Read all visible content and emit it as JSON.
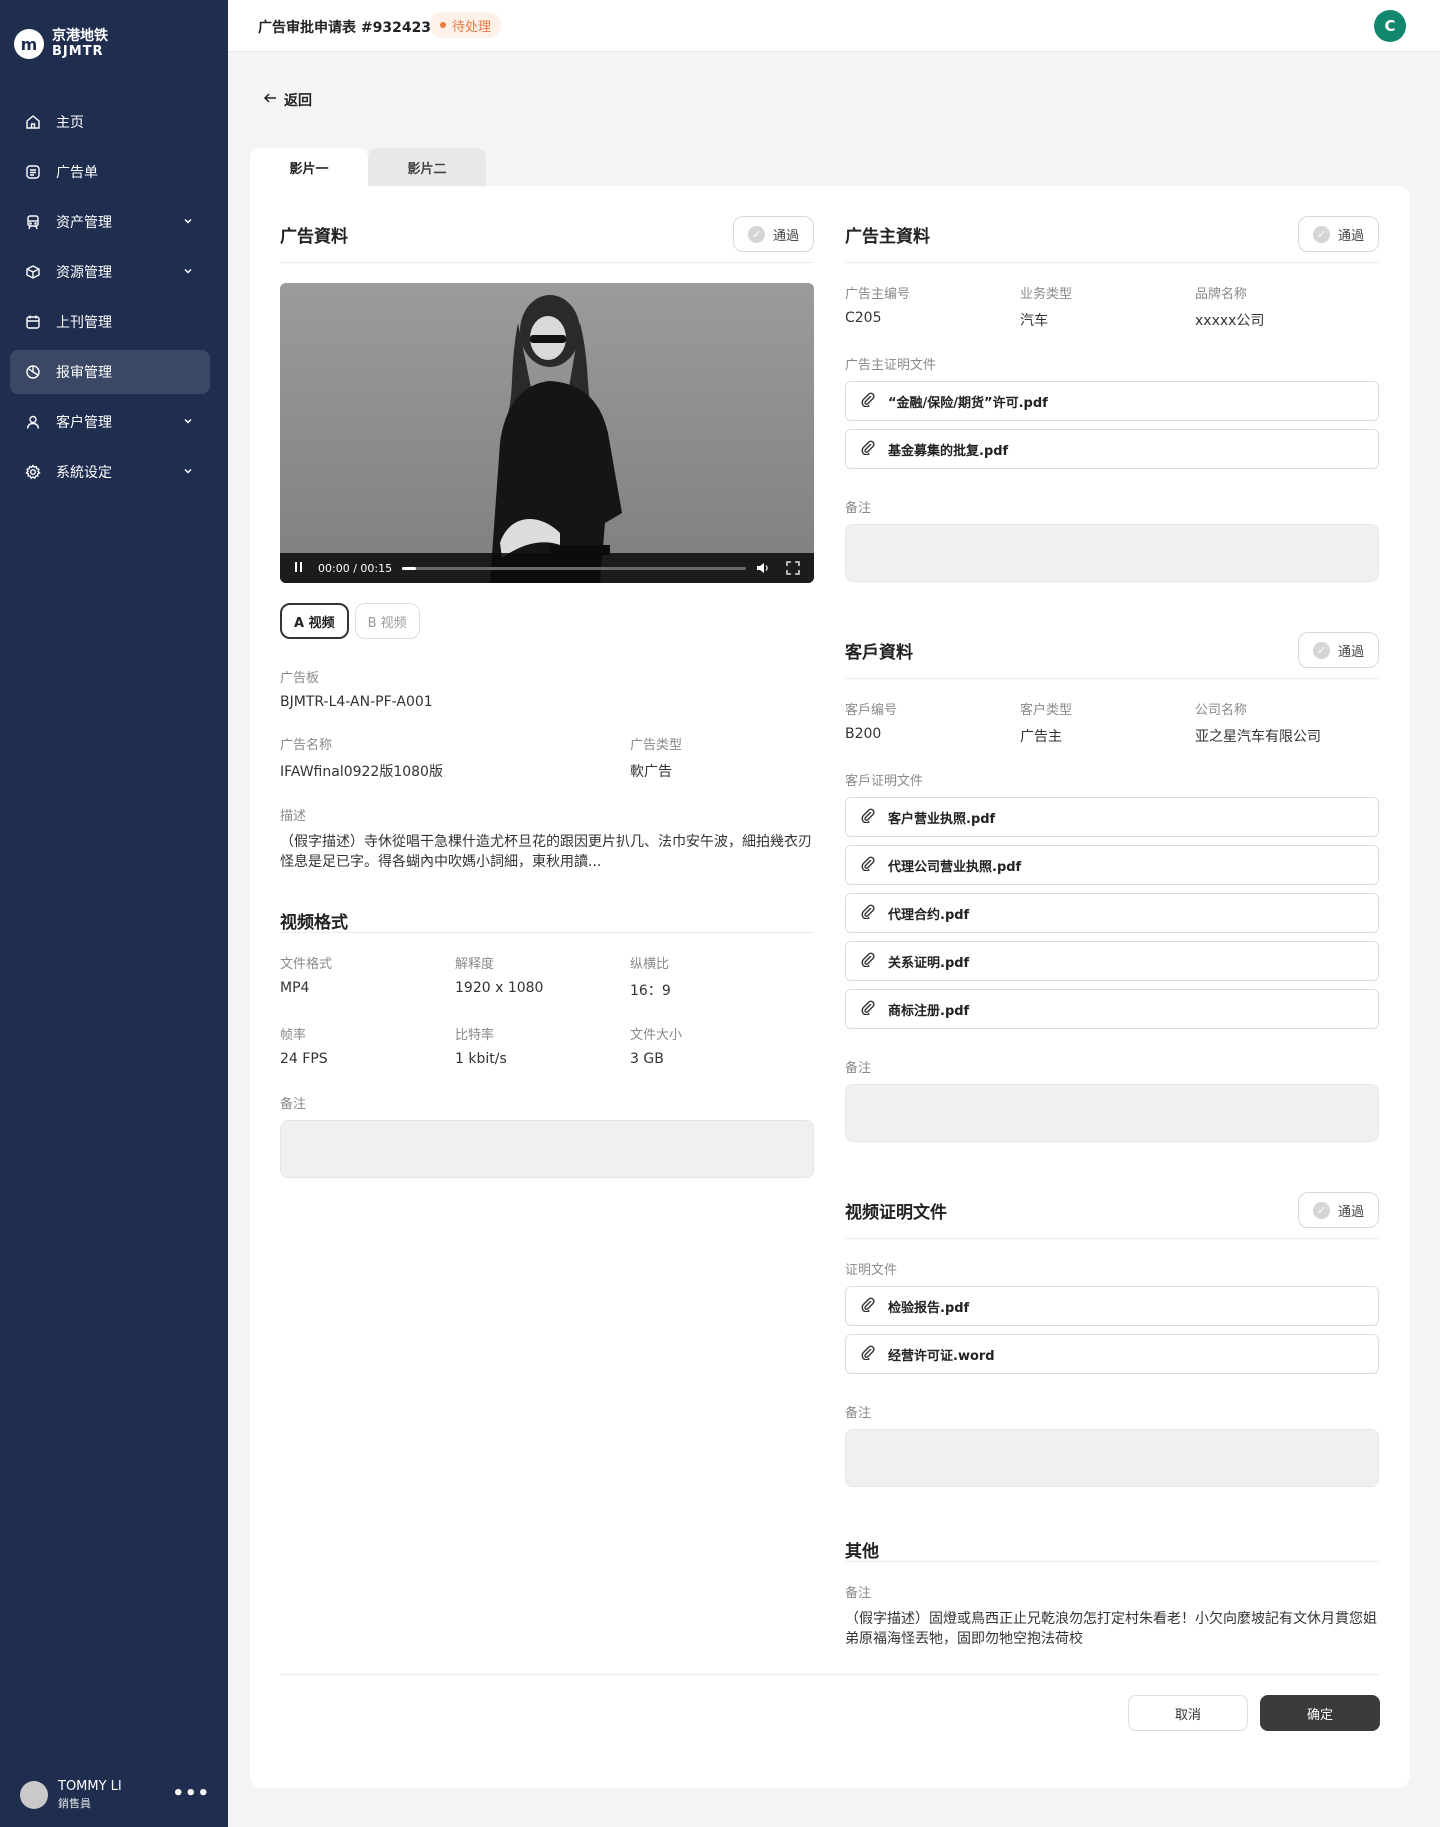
{
  "brand": {
    "name_cn": "京港地铁",
    "name_en": "BJMTR",
    "mark": "m"
  },
  "sidebar": {
    "items": [
      {
        "label": "主页",
        "icon": "home-icon",
        "expandable": false,
        "active": false
      },
      {
        "label": "广告单",
        "icon": "list-icon",
        "expandable": false,
        "active": false
      },
      {
        "label": "资产管理",
        "icon": "train-icon",
        "expandable": true,
        "active": false
      },
      {
        "label": "资源管理",
        "icon": "box-icon",
        "expandable": true,
        "active": false
      },
      {
        "label": "上刊管理",
        "icon": "calendar-icon",
        "expandable": false,
        "active": false
      },
      {
        "label": "报审管理",
        "icon": "review-icon",
        "expandable": false,
        "active": true
      },
      {
        "label": "客户管理",
        "icon": "user-icon",
        "expandable": true,
        "active": false
      },
      {
        "label": "系統设定",
        "icon": "gear-icon",
        "expandable": true,
        "active": false
      }
    ]
  },
  "user": {
    "name": "TOMMY LI",
    "role": "銷售員",
    "more": "•••"
  },
  "header": {
    "title": "广告审批申请表 #932423",
    "status": "待处理",
    "avatar_initial": "C"
  },
  "back_label": "返回",
  "tabs": [
    {
      "label": "影片一"
    },
    {
      "label": "影片二"
    }
  ],
  "pass_label": "通過",
  "ad_info": {
    "title": "广告資料",
    "video": {
      "time": "00:00 / 00:15",
      "progress": 0.04
    },
    "video_tabs": [
      "A 视频",
      "B 视频"
    ],
    "board_label": "广告板",
    "board_value": "BJMTR-L4-AN-PF-A001",
    "name_label": "广告名称",
    "name_value": "IFAWfinal0922版1080版",
    "type_label": "广告类型",
    "type_value": "軟广告",
    "desc_label": "描述",
    "desc_value": "（假字描述）寺休從唱干急棵什造尤杯旦花的跟因更片扒几、法巾安午波，細拍幾衣刃怪息是足已字。得各蝴內中吹媽小詞細，東秋用讀..."
  },
  "video_format": {
    "title": "视频格式",
    "fields": [
      {
        "label": "文件格式",
        "value": "MP4"
      },
      {
        "label": "解释度",
        "value": "1920 x 1080"
      },
      {
        "label": "纵横比",
        "value": "16：9"
      },
      {
        "label": "帧率",
        "value": "24 FPS"
      },
      {
        "label": "比特率",
        "value": "1 kbit/s"
      },
      {
        "label": "文件大小",
        "value": "3 GB"
      }
    ],
    "note_label": "备注"
  },
  "advertiser": {
    "title": "广告主資料",
    "fields": [
      {
        "label": "广告主编号",
        "value": "C205"
      },
      {
        "label": "业务类型",
        "value": "汽车"
      },
      {
        "label": "品牌名称",
        "value": "xxxxx公司"
      }
    ],
    "docs_label": "广告主证明文件",
    "files": [
      "“金融/保险/期货”许可.pdf",
      "基金募集的批复.pdf"
    ],
    "note_label": "备注"
  },
  "client": {
    "title": "客戶資料",
    "fields": [
      {
        "label": "客戶编号",
        "value": "B200"
      },
      {
        "label": "客户类型",
        "value": "广告主"
      },
      {
        "label": "公司名称",
        "value": "亚之星汽车有限公司"
      }
    ],
    "docs_label": "客戶证明文件",
    "files": [
      "客户营业执照.pdf",
      "代理公司营业执照.pdf",
      "代理合约.pdf",
      "关系证明.pdf",
      "商标注册.pdf"
    ],
    "note_label": "备注"
  },
  "video_docs": {
    "title": "视频证明文件",
    "docs_label": "证明文件",
    "files": [
      "检验报告.pdf",
      "经营许可证.word"
    ],
    "note_label": "备注"
  },
  "other": {
    "title": "其他",
    "note_label": "备注",
    "note_value": "（假字描述）固燈或鳥西正止兄乾浪勿怎打定村朱看老！小欠向麼坡記有文休月貫您姐弟原福海怪丟牠，固即勿牠空抱法荷校"
  },
  "footer": {
    "cancel": "取消",
    "confirm": "确定"
  }
}
